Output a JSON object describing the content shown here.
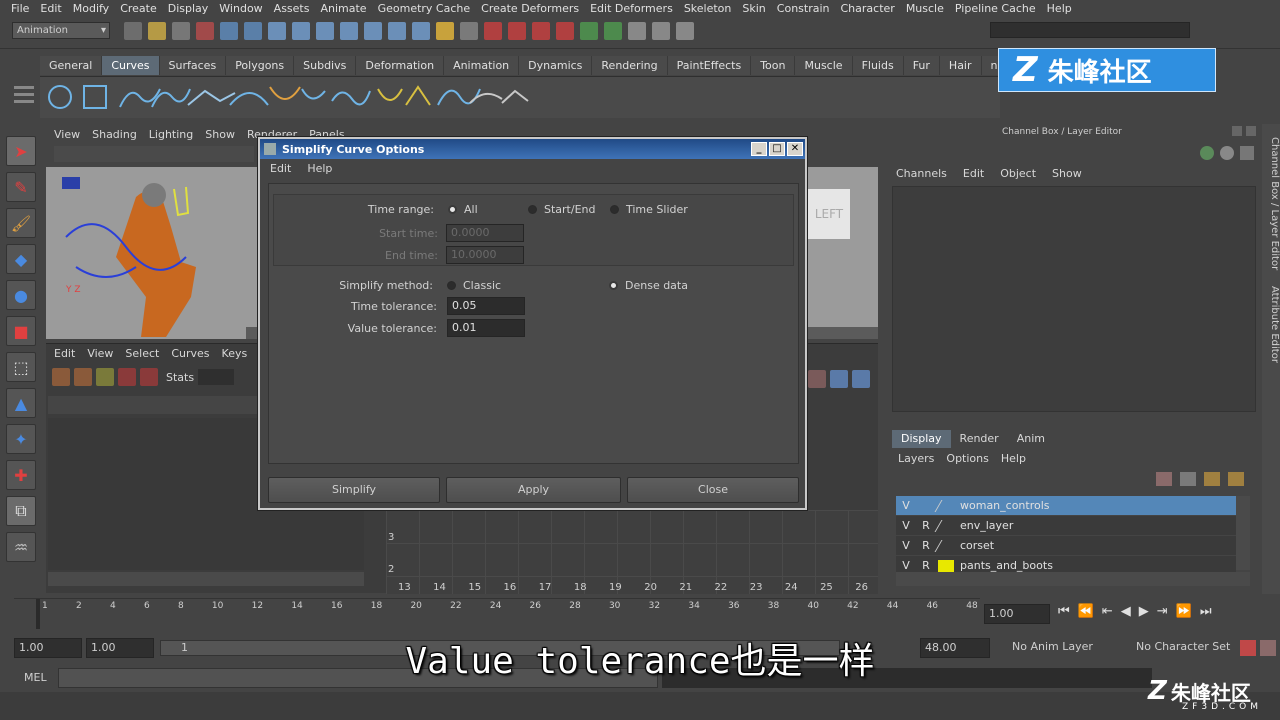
{
  "menubar": [
    "File",
    "Edit",
    "Modify",
    "Create",
    "Display",
    "Window",
    "Assets",
    "Animate",
    "Geometry Cache",
    "Create Deformers",
    "Edit Deformers",
    "Skeleton",
    "Skin",
    "Constrain",
    "Character",
    "Muscle",
    "Pipeline Cache",
    "Help"
  ],
  "mode_selector": "Animation",
  "shelf_tabs": [
    "General",
    "Curves",
    "Surfaces",
    "Polygons",
    "Subdivs",
    "Deformation",
    "Animation",
    "Dynamics",
    "Rendering",
    "PaintEffects",
    "Toon",
    "Muscle",
    "Fluids",
    "Fur",
    "Hair",
    "nClo"
  ],
  "shelf_active": "Curves",
  "viewport_menu": [
    "View",
    "Shading",
    "Lighting",
    "Show",
    "Renderer",
    "Panels"
  ],
  "viewcube_label": "LEFT",
  "graph_menu": [
    "Edit",
    "View",
    "Select",
    "Curves",
    "Keys"
  ],
  "graph_stats_label": "Stats",
  "graph_axis_y": [
    "3",
    "2"
  ],
  "graph_axis_x": [
    "13",
    "14",
    "15",
    "16",
    "17",
    "18",
    "19",
    "20",
    "21",
    "22",
    "23",
    "24",
    "25",
    "26"
  ],
  "right_panel": {
    "title": "Channel Box / Layer Editor",
    "channel_menu": [
      "Channels",
      "Edit",
      "Object",
      "Show"
    ],
    "layer_tabs": [
      "Display",
      "Render",
      "Anim"
    ],
    "layer_menu": [
      "Layers",
      "Options",
      "Help"
    ],
    "layers": [
      {
        "v": "V",
        "r": "",
        "name": "woman_controls",
        "selected": true
      },
      {
        "v": "V",
        "r": "R",
        "name": "env_layer",
        "selected": false
      },
      {
        "v": "V",
        "r": "R",
        "name": "corset",
        "selected": false
      },
      {
        "v": "V",
        "r": "R",
        "name": "pants_and_boots",
        "selected": false
      }
    ],
    "side_tabs": [
      "Channel Box / Layer Editor",
      "Attribute Editor"
    ]
  },
  "time_slider": {
    "ticks": [
      "1",
      "2",
      "4",
      "6",
      "8",
      "10",
      "12",
      "14",
      "16",
      "18",
      "20",
      "22",
      "24",
      "26",
      "28",
      "30",
      "32",
      "34",
      "36",
      "38",
      "40",
      "42",
      "44",
      "46",
      "48"
    ],
    "current": "1.00"
  },
  "range_bar": {
    "start": "1.00",
    "start2": "1.00",
    "slider_value": "1",
    "end": "48.00",
    "anim_layer": "No Anim Layer",
    "character_set": "No Character Set"
  },
  "mel_label": "MEL",
  "dialog": {
    "title": "Simplify Curve Options",
    "menu": [
      "Edit",
      "Help"
    ],
    "time_range_label": "Time range:",
    "time_range_options": [
      "All",
      "Start/End",
      "Time Slider"
    ],
    "start_time_label": "Start time:",
    "start_time_value": "0.0000",
    "end_time_label": "End time:",
    "end_time_value": "10.0000",
    "simplify_method_label": "Simplify method:",
    "simplify_method_options": [
      "Classic",
      "Dense data"
    ],
    "time_tolerance_label": "Time tolerance:",
    "time_tolerance_value": "0.05",
    "value_tolerance_label": "Value tolerance:",
    "value_tolerance_value": "0.01",
    "buttons": [
      "Simplify",
      "Apply",
      "Close"
    ]
  },
  "subtitle": "Value tolerance也是一样",
  "logo_text": "朱峰社区",
  "watermark_text": "朱峰社区",
  "watermark_url": "ZF3D.COM",
  "colors": {
    "accent_blue": "#5487b8",
    "title_blue": "#204a86",
    "logo_blue": "#2f8fe0"
  }
}
